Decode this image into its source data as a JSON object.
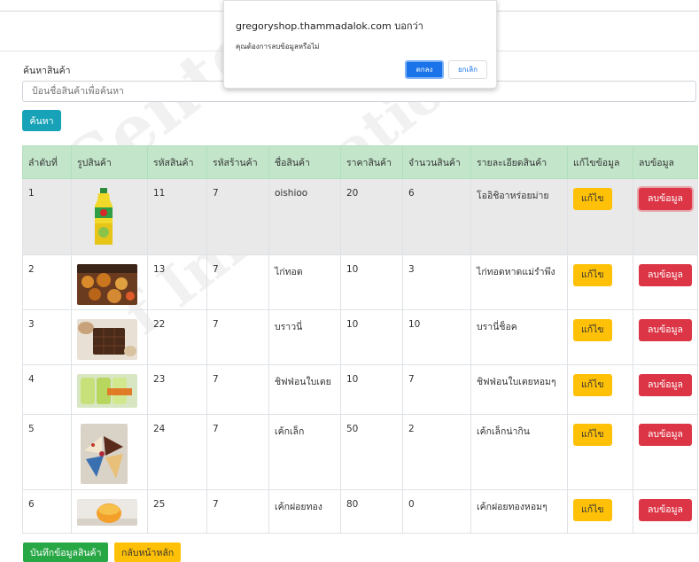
{
  "search": {
    "label": "ค้นหาสินค้า",
    "placeholder": "ป้อนชื่อสินค้าเพื่อค้นหา",
    "button": "ค้นหา"
  },
  "table": {
    "headers": [
      "ลำดับที่",
      "รูปสินค้า",
      "รหัสสินค้า",
      "รหัสร้านค้า",
      "ชื่อสินค้า",
      "ราคาสินค้า",
      "จำนวนสินค้า",
      "รายละเอียดสินค้า",
      "แก้ไขข้อมูล",
      "ลบข้อมูล"
    ],
    "rows": [
      {
        "no": "1",
        "image": "green-tea-bottle-image",
        "product_id": "11",
        "shop_id": "7",
        "name": "oishioo",
        "price": "20",
        "qty": "6",
        "detail": "โออิชิอาหร่อยม่าย",
        "edit": "แก้ไข",
        "delete": "ลบข้อมูล"
      },
      {
        "no": "2",
        "image": "fried-chicken-image",
        "product_id": "13",
        "shop_id": "7",
        "name": "ไก่ทอด",
        "price": "10",
        "qty": "3",
        "detail": "ไก่ทอดหาดแม่รำพึง",
        "edit": "แก้ไข",
        "delete": "ลบข้อมูล"
      },
      {
        "no": "3",
        "image": "brownie-image",
        "product_id": "22",
        "shop_id": "7",
        "name": "บราวนี่",
        "price": "10",
        "qty": "10",
        "detail": "บรานี่ช็อค",
        "edit": "แก้ไข",
        "delete": "ลบข้อมูล"
      },
      {
        "no": "4",
        "image": "chiffon-pandan-image",
        "product_id": "23",
        "shop_id": "7",
        "name": "ชิฟฟ่อนใบเตย",
        "price": "10",
        "qty": "7",
        "detail": "ชิฟฟ่อนใบเตยหอมๆ",
        "edit": "แก้ไข",
        "delete": "ลบข้อมูล"
      },
      {
        "no": "5",
        "image": "cake-slices-image",
        "product_id": "24",
        "shop_id": "7",
        "name": "เค้กเล็ก",
        "price": "50",
        "qty": "2",
        "detail": "เค้กเล็กน่ากิน",
        "edit": "แก้ไข",
        "delete": "ลบข้อมูล"
      },
      {
        "no": "6",
        "image": "foi-thong-cake-image",
        "product_id": "25",
        "shop_id": "7",
        "name": "เค้กฝอยทอง",
        "price": "80",
        "qty": "0",
        "detail": "เค้กฝอยทองหอมๆ",
        "edit": "แก้ไข",
        "delete": "ลบข้อมูล"
      }
    ]
  },
  "footer": {
    "save_button": "บันทึกข้อมูลสินค้า",
    "back_button": "กลับหน้าหลัก"
  },
  "dialog": {
    "title": "gregoryshop.thammadalok.com บอกว่า",
    "message": "คุณต้องการลบข้อมูลหรือไม่",
    "ok": "ตกลง",
    "cancel": "ยกเลิก"
  },
  "colors": {
    "header_bg": "#c3e6cb",
    "search_button": "#17a2b8",
    "edit_button": "#ffc107",
    "delete_button": "#dc3545",
    "save_button": "#28a745",
    "dialog_ok": "#1a73e8"
  }
}
